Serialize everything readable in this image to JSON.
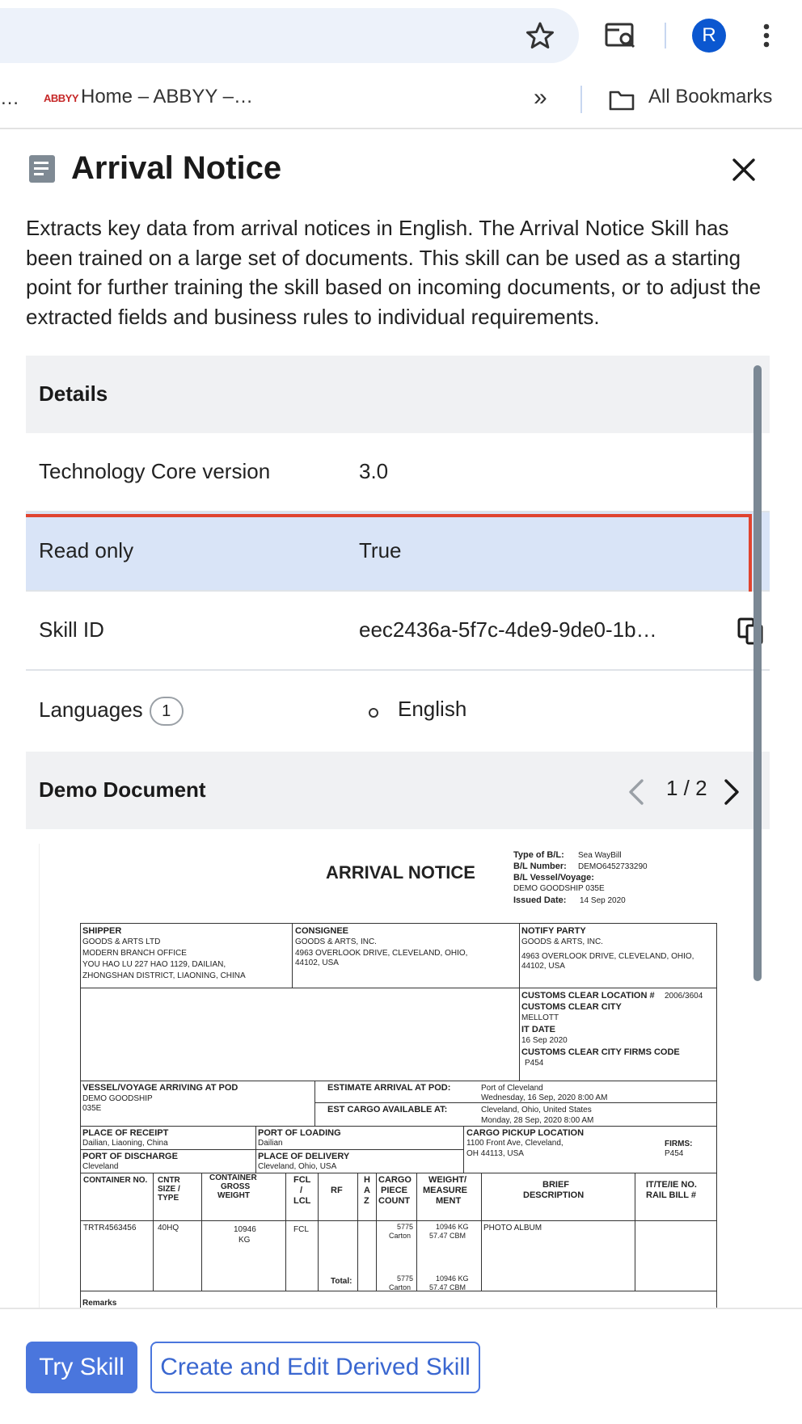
{
  "browser": {
    "avatar_letter": "R",
    "bookmarks_leading": "…",
    "bookmark_favicon_text": "ABBYY",
    "bookmark_home": "Home – ABBYY –…",
    "bookmarks_overflow": "»",
    "all_bookmarks": "All Bookmarks"
  },
  "panel": {
    "title": "Arrival Notice",
    "description": "Extracts key data from arrival notices in English. The Arrival Notice Skill has been trained on a large set of documents. This skill can be used as a starting point for further training the skill based on incoming documents, or to adjust the extracted fields and business rules to individual requirements."
  },
  "details": {
    "header": "Details",
    "rows": [
      {
        "label": "Technology Core version",
        "value": "3.0"
      },
      {
        "label": "Read only",
        "value": "True"
      },
      {
        "label": "Skill ID",
        "value": "eec2436a-5f7c-4de9-9de0-1b…"
      }
    ],
    "languages_label": "Languages",
    "languages_count": "1",
    "languages": [
      "English"
    ]
  },
  "demo": {
    "header": "Demo Document",
    "pager": "1 / 2"
  },
  "document": {
    "title": "ARRIVAL NOTICE",
    "bl_type_label": "Type of B/L:",
    "bl_type": "Sea WayBill",
    "bl_number_label": "B/L Number:",
    "bl_number": "DEMO6452733290",
    "bl_vessel_label": "B/L Vessel/Voyage:",
    "bl_vessel": "DEMO GOODSHIP 035E",
    "issued_label": "Issued Date:",
    "issued": "14 Sep 2020",
    "shipper_label": "SHIPPER",
    "shipper_lines": [
      "GOODS & ARTS LTD",
      "MODERN BRANCH OFFICE",
      "YOU HAO LU 227 HAO 1129, DAILIAN,",
      "ZHONGSHAN DISTRICT, LIAONING, CHINA"
    ],
    "consignee_label": "CONSIGNEE",
    "consignee_lines": [
      "GOODS & ARTS, INC.",
      "4963 OVERLOOK DRIVE, CLEVELAND, OHIO,",
      "44102, USA"
    ],
    "notify_label": "NOTIFY PARTY",
    "notify_lines": [
      "GOODS & ARTS, INC.",
      "4963 OVERLOOK DRIVE, CLEVELAND, OHIO,",
      "44102, USA"
    ],
    "customs_location_label": "CUSTOMS CLEAR LOCATION #",
    "customs_location": "2006/3604",
    "customs_city_label": "CUSTOMS CLEAR CITY",
    "customs_city": "MELLOTT",
    "it_date_label": "IT DATE",
    "it_date": "16 Sep 2020",
    "firms_code_label": "CUSTOMS CLEAR CITY FIRMS CODE",
    "firms_code": "P454",
    "vessel_label": "VESSEL/VOYAGE ARRIVING AT POD",
    "vessel_lines": [
      "DEMO GOODSHIP",
      "035E"
    ],
    "eta_label": "ESTIMATE ARRIVAL AT POD:",
    "eta_place": "Port of Cleveland",
    "eta_date": "Wednesday, 16 Sep, 2020 8:00 AM",
    "cargo_avail_label": "EST CARGO AVAILABLE AT:",
    "cargo_avail_place": "Cleveland,  Ohio, United States",
    "cargo_avail_date": "Monday, 28 Sep, 2020 8:00 AM",
    "receipt_label": "PLACE OF RECEIPT",
    "receipt": "Dailian, Liaoning, China",
    "loading_label": "PORT OF LOADING",
    "loading": "Dailian",
    "pickup_label": "CARGO PICKUP LOCATION",
    "pickup_lines": [
      "1100 Front Ave, Cleveland,",
      "OH 44113, USA"
    ],
    "firms_label": "FIRMS:",
    "firms": "P454",
    "discharge_label": "PORT OF DISCHARGE",
    "discharge": "Cleveland",
    "delivery_label": "PLACE OF DELIVERY",
    "delivery": "Cleveland, Ohio, USA",
    "col_container": "CONTAINER NO.",
    "col_size": [
      "CNTR",
      "SIZE /",
      "TYPE"
    ],
    "col_weight": [
      "CONTAINER",
      "GROSS",
      "WEIGHT"
    ],
    "col_fcl": [
      "FCL",
      "/",
      "LCL"
    ],
    "col_rf": "RF",
    "col_haz": [
      "H",
      "A",
      "Z"
    ],
    "col_piece": [
      "CARGO",
      "PIECE",
      "COUNT"
    ],
    "col_measure": [
      "WEIGHT/",
      "MEASURE",
      "MENT"
    ],
    "col_desc": [
      "BRIEF",
      "DESCRIPTION"
    ],
    "col_rail": [
      "IT/TE/IE NO.",
      "RAIL BILL #"
    ],
    "row_container": "TRTR4563456",
    "row_size": "40HQ",
    "row_weight": [
      "10946",
      "KG"
    ],
    "row_fcl": "FCL",
    "row_piece": [
      "5775",
      "Carton"
    ],
    "row_measure": [
      "10946 KG",
      "57.47 CBM"
    ],
    "row_desc": "PHOTO ALBUM",
    "total_label": "Total:",
    "total_piece": [
      "5775",
      "Carton"
    ],
    "total_measure": [
      "10946 KG",
      "57.47 CBM"
    ],
    "remarks": "Remarks"
  },
  "footer": {
    "try_skill": "Try Skill",
    "derived": "Create and Edit Derived Skill"
  }
}
